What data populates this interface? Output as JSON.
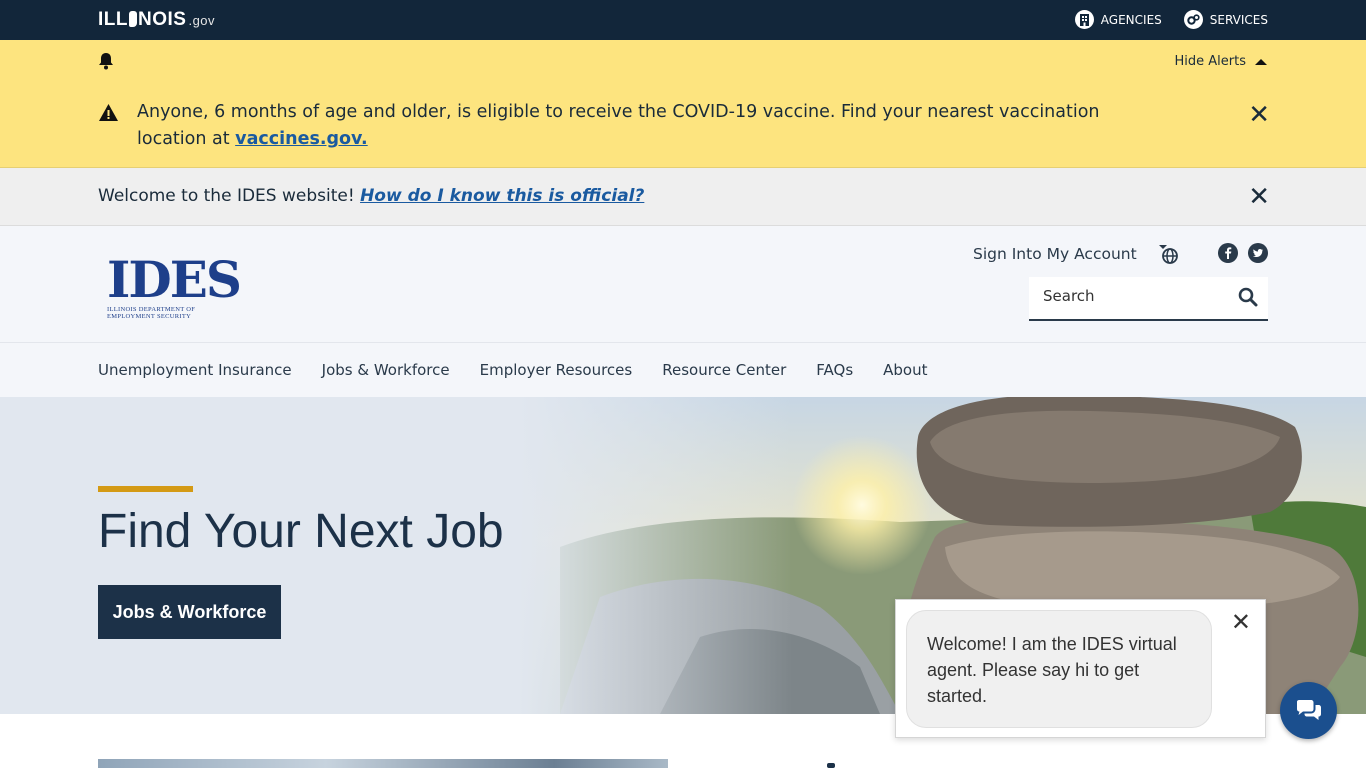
{
  "topbar": {
    "logo_main": "ILL",
    "logo_rest": "NOIS",
    "logo_gov": ".gov",
    "links": [
      {
        "label": "AGENCIES",
        "icon": "building-icon"
      },
      {
        "label": "SERVICES",
        "icon": "gears-icon"
      }
    ]
  },
  "alerts": {
    "hide_label": "Hide Alerts",
    "message": "Anyone, 6 months of age and older, is eligible to receive the COVID-19 vaccine. Find your nearest vaccination location at ",
    "link_text": "vaccines.gov."
  },
  "welcome": {
    "text": "Welcome to the IDES website! ",
    "link_text": "How do I know this is official?"
  },
  "header": {
    "brand_big": "IDES",
    "brand_line1": "ILLINOIS DEPARTMENT OF",
    "brand_line2": "EMPLOYMENT SECURITY",
    "signin": "Sign Into My Account",
    "search_placeholder": "Search"
  },
  "nav": {
    "items": [
      "Unemployment Insurance",
      "Jobs & Workforce",
      "Employer Resources",
      "Resource Center",
      "FAQs",
      "About"
    ]
  },
  "hero": {
    "title": "Find Your Next Job",
    "button": "Jobs & Workforce"
  },
  "chat": {
    "message": "Welcome! I am the IDES virtual agent. Please say hi to get started."
  },
  "colors": {
    "topbar": "#12263a",
    "alert": "#fde47f",
    "accent": "#d49a14",
    "primary": "#1c3148",
    "link": "#1a5aa0",
    "chat_button": "#1b4f8e"
  }
}
